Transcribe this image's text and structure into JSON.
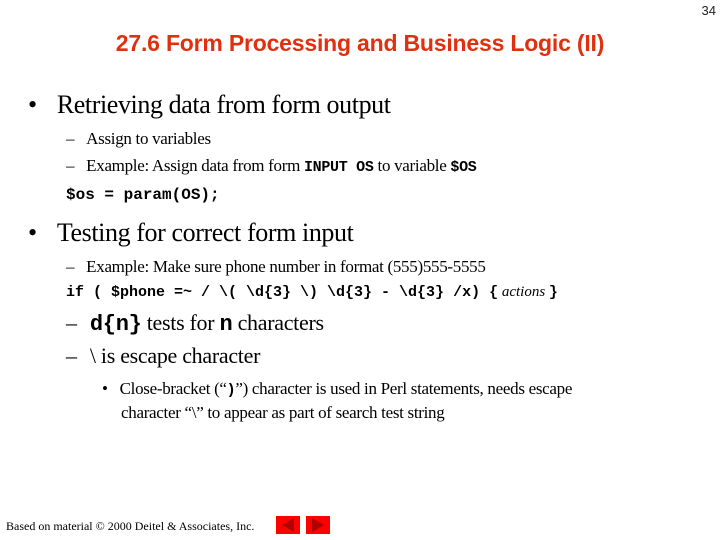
{
  "slide": {
    "number": "34",
    "title": "27.6 Form Processing and Business Logic (II)"
  },
  "content": {
    "bullet1": {
      "text": "Retrieving data from form output",
      "sub1": "Assign to variables",
      "sub2": {
        "prefix": "Example: Assign data from form ",
        "code1": "INPUT OS",
        "middle": " to variable ",
        "code2": "$OS"
      },
      "code_line": "$os = param(OS);"
    },
    "bullet2": {
      "text": "Testing for correct form input",
      "sub1": "Example: Make sure phone number in format (555)555-5555",
      "code_line": {
        "code": "if ( $phone =~ / \\( \\d{3} \\) \\d{3} - \\d{3} /x) {",
        "italic": " actions ",
        "end": "}"
      },
      "sub2": {
        "code1": "d{n}",
        "middle": " tests for ",
        "code2": "n",
        "suffix": " characters"
      },
      "sub3": {
        "glyph": "\\",
        "suffix": " is escape character"
      },
      "sub3_bullet": {
        "line1_prefix": "Close-bracket (“",
        "line1_code": ")",
        "line1_suffix": "”) character is used in Perl statements, needs escape",
        "line2": "character “\\” to appear as part of search test string"
      }
    }
  },
  "bullet_glyph": "•",
  "dash_glyph": "–",
  "footer": {
    "text": "Based on material © 2000 Deitel & Associates, Inc."
  },
  "nav": {
    "prev_icon": "triangle-left",
    "next_icon": "triangle-right",
    "button_color": "#ff0000",
    "arrow_color": "#b00000"
  },
  "colors": {
    "title": "#e03010"
  }
}
